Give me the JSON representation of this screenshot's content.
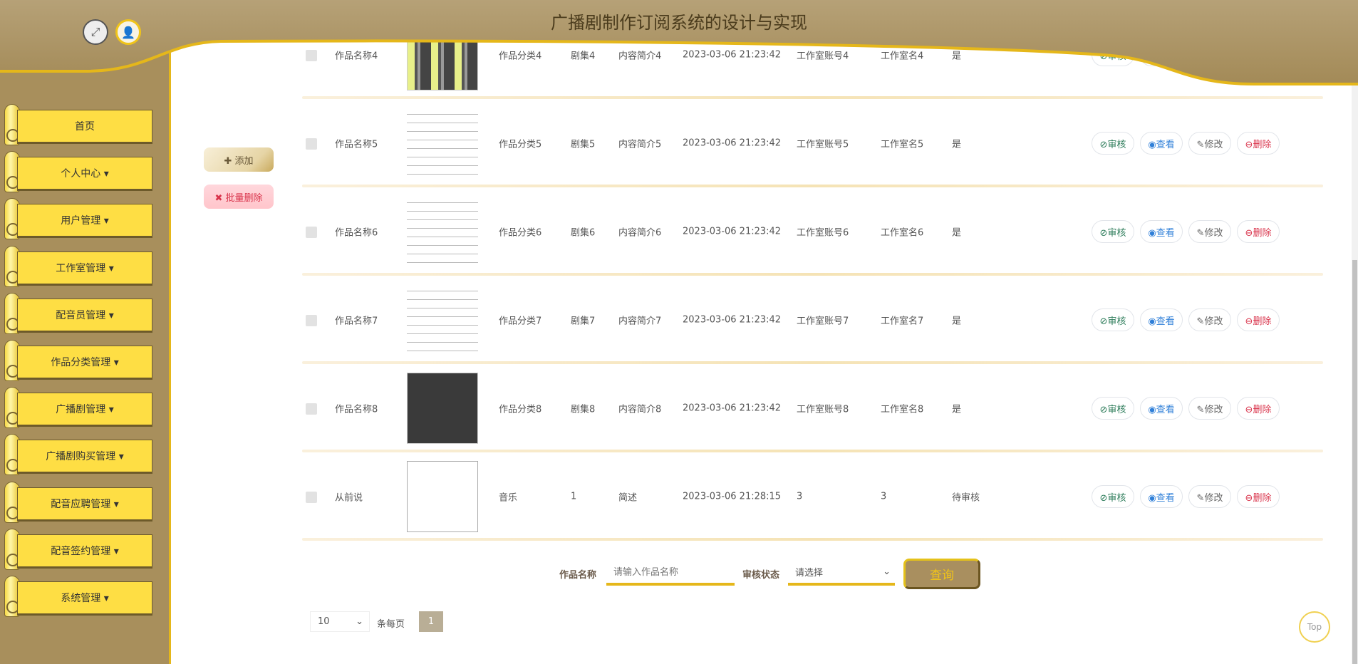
{
  "header": {
    "title": "广播剧制作订阅系统的设计与实现",
    "fullscreen_icon": "expand-icon",
    "user_icon": "user-icon"
  },
  "sidebar": {
    "items": [
      {
        "label": "首页"
      },
      {
        "label": "个人中心 ▾"
      },
      {
        "label": "用户管理 ▾"
      },
      {
        "label": "工作室管理 ▾"
      },
      {
        "label": "配音员管理 ▾"
      },
      {
        "label": "作品分类管理 ▾"
      },
      {
        "label": "广播剧管理 ▾"
      },
      {
        "label": "广播剧购买管理 ▾"
      },
      {
        "label": "配音应聘管理 ▾"
      },
      {
        "label": "配音签约管理 ▾"
      },
      {
        "label": "系统管理 ▾"
      }
    ]
  },
  "toolbar": {
    "add_label": "✚ 添加",
    "batch_delete_label": "✖ 批量删除"
  },
  "actions": {
    "audit": "⊘审核",
    "view": "◉查看",
    "edit": "✎修改",
    "delete": "⊖删除"
  },
  "rows": [
    {
      "name": "作品名称4",
      "category": "作品分类4",
      "episode": "剧集4",
      "intro": "内容简介4",
      "time": "2023-03-06 21:23:42",
      "account": "工作室账号4",
      "studio": "工作室名4",
      "status": "是",
      "image": "grid"
    },
    {
      "name": "作品名称5",
      "category": "作品分类5",
      "episode": "剧集5",
      "intro": "内容简介5",
      "time": "2023-03-06 21:23:42",
      "account": "工作室账号5",
      "studio": "工作室名5",
      "status": "是",
      "image": "score"
    },
    {
      "name": "作品名称6",
      "category": "作品分类6",
      "episode": "剧集6",
      "intro": "内容简介6",
      "time": "2023-03-06 21:23:42",
      "account": "工作室账号6",
      "studio": "工作室名6",
      "status": "是",
      "image": "score"
    },
    {
      "name": "作品名称7",
      "category": "作品分类7",
      "episode": "剧集7",
      "intro": "内容简介7",
      "time": "2023-03-06 21:23:42",
      "account": "工作室账号7",
      "studio": "工作室名7",
      "status": "是",
      "image": "score"
    },
    {
      "name": "作品名称8",
      "category": "作品分类8",
      "episode": "剧集8",
      "intro": "内容简介8",
      "time": "2023-03-06 21:23:42",
      "account": "工作室账号8",
      "studio": "工作室名8",
      "status": "是",
      "image": "dark"
    },
    {
      "name": "从前说",
      "category": "音乐",
      "episode": "1",
      "intro": "简述",
      "time": "2023-03-06 21:28:15",
      "account": "3",
      "studio": "3",
      "status": "待审核",
      "image": "broken"
    }
  ],
  "search": {
    "name_label": "作品名称",
    "name_placeholder": "请输入作品名称",
    "status_label": "审核状态",
    "status_value": "请选择",
    "query_label": "查询"
  },
  "pagination": {
    "page_size": "10",
    "per_page_label": "条每页",
    "current_page": "1"
  },
  "back_to_top": "Top",
  "colors": {
    "header": "#a88f5c",
    "accent": "#e5b71a",
    "menu": "#fede44"
  }
}
